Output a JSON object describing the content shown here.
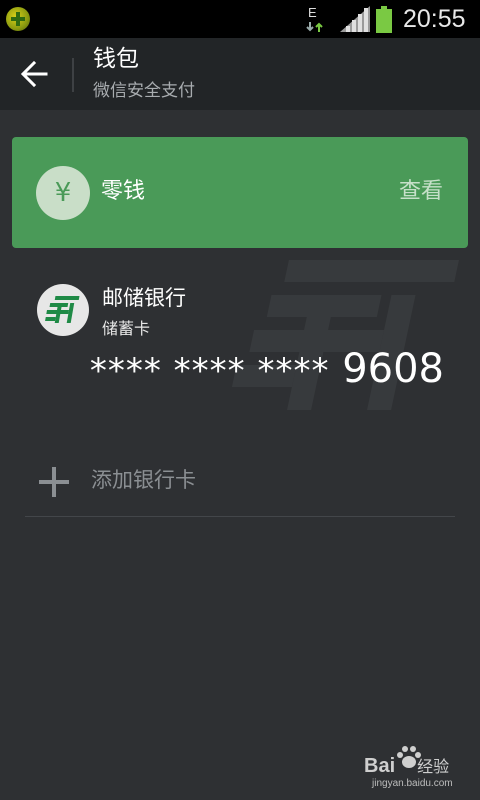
{
  "status_bar": {
    "network_type": "E",
    "time": "20:55"
  },
  "action_bar": {
    "title": "钱包",
    "subtitle": "微信安全支付"
  },
  "change_card": {
    "icon_symbol": "¥",
    "label": "零钱",
    "action": "查看",
    "background": "#4a9a58"
  },
  "bank_card": {
    "bank_name": "邮储银行",
    "card_type": "储蓄卡",
    "masked_number": "**** **** ****",
    "last_four": "9608"
  },
  "add_card": {
    "label": "添加银行卡"
  },
  "watermark": {
    "brand": "Bai",
    "brand_cn": "经验",
    "url": "jingyan.baidu.com"
  }
}
